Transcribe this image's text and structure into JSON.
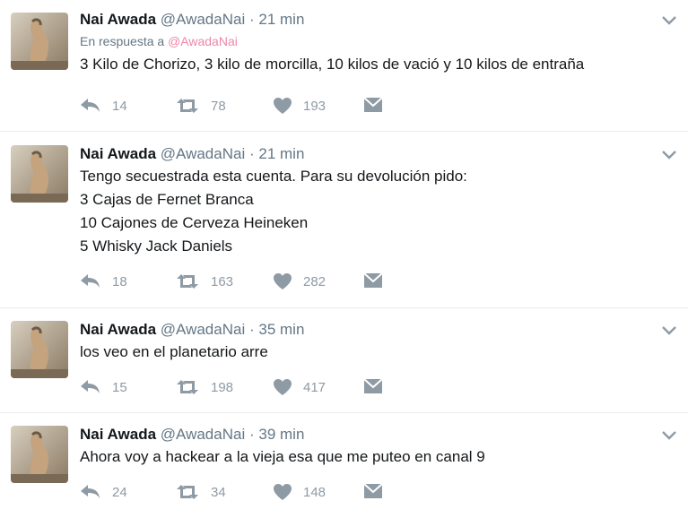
{
  "tweets": [
    {
      "name": "Nai Awada",
      "handle": "@AwadaNai",
      "dot": "·",
      "time": "21 min",
      "reply_prefix": "En respuesta a",
      "reply_to": "@AwadaNai",
      "lines": [
        "3 Kilo de Chorizo, 3 kilo de morcilla, 10 kilos de vació y 10 kilos de entraña"
      ],
      "replies": "14",
      "retweets": "78",
      "likes": "193"
    },
    {
      "name": "Nai Awada",
      "handle": "@AwadaNai",
      "dot": "·",
      "time": "21 min",
      "lines": [
        "Tengo secuestrada esta cuenta. Para su devolución pido:",
        "3 Cajas de Fernet Branca",
        "10 Cajones de Cerveza Heineken",
        "5 Whisky Jack Daniels"
      ],
      "replies": "18",
      "retweets": "163",
      "likes": "282"
    },
    {
      "name": "Nai Awada",
      "handle": "@AwadaNai",
      "dot": "·",
      "time": "35 min",
      "lines": [
        "los veo en el planetario arre"
      ],
      "replies": "15",
      "retweets": "198",
      "likes": "417"
    },
    {
      "name": "Nai Awada",
      "handle": "@AwadaNai",
      "dot": "·",
      "time": "39 min",
      "lines": [
        "Ahora voy a hackear a la vieja esa que me puteo en canal 9"
      ],
      "replies": "24",
      "retweets": "34",
      "likes": "148"
    }
  ],
  "icons": {
    "reply": "reply-icon",
    "retweet": "retweet-icon",
    "like": "heart-icon",
    "dm": "envelope-icon",
    "more": "chevron-down-icon"
  },
  "colors": {
    "text": "#14171a",
    "muted": "#657786",
    "action": "#8e9aa4",
    "mention": "#e0245e"
  }
}
